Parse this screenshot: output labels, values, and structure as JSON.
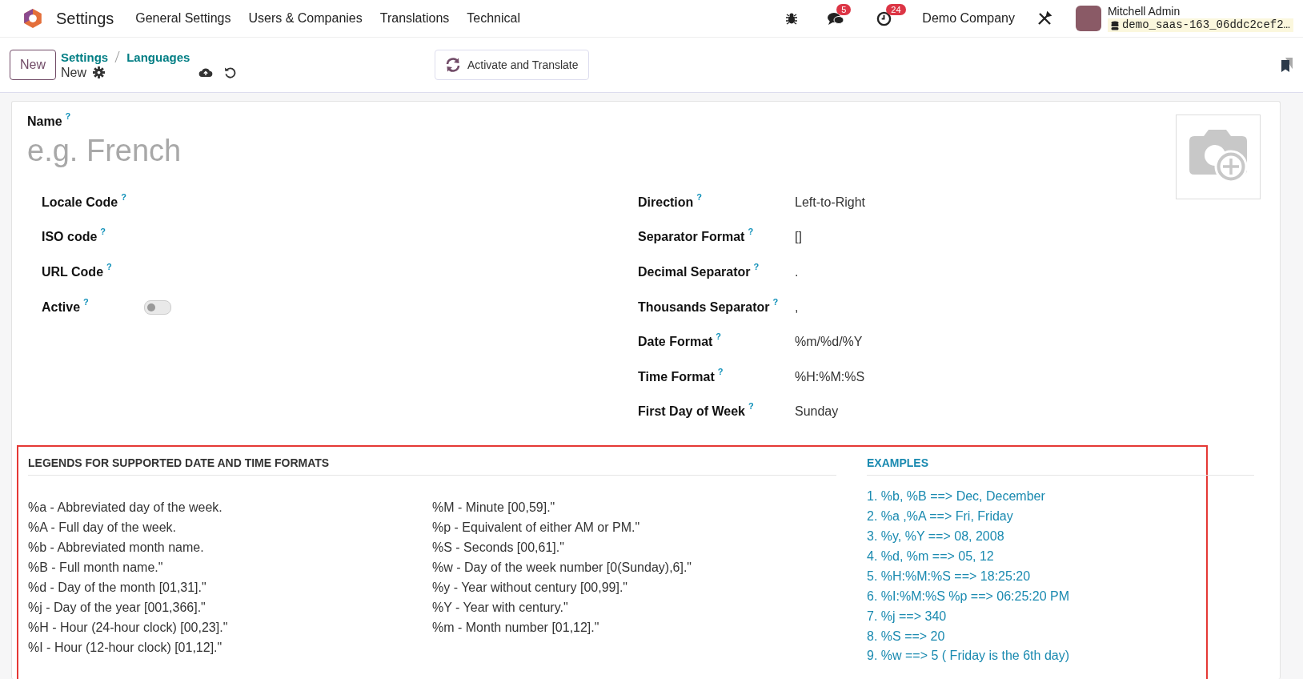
{
  "navbar": {
    "app_name": "Settings",
    "menu": [
      "General Settings",
      "Users & Companies",
      "Translations",
      "Technical"
    ],
    "chat_badge": "5",
    "activity_badge": "24",
    "company": "Demo Company",
    "user": {
      "name": "Mitchell Admin",
      "database": "demo_saas-163_06ddc2cef2…"
    }
  },
  "control_panel": {
    "new_button": "New",
    "breadcrumbs": [
      "Settings",
      "Languages"
    ],
    "record": "New",
    "action_button": "Activate and Translate"
  },
  "form": {
    "name": {
      "label": "Name",
      "help": "?",
      "placeholder": "e.g. French"
    },
    "left_fields": [
      {
        "kind": "text",
        "label": "Locale Code",
        "help": "?"
      },
      {
        "kind": "text",
        "label": "ISO code",
        "help": "?"
      },
      {
        "kind": "text",
        "label": "URL Code",
        "help": "?"
      },
      {
        "kind": "toggle",
        "label": "Active",
        "help": "?",
        "on": false
      }
    ],
    "right_fields": [
      {
        "label": "Direction",
        "help": "?",
        "value": "Left-to-Right"
      },
      {
        "label": "Separator Format",
        "help": "?",
        "value": "[]"
      },
      {
        "label": "Decimal Separator",
        "help": "?",
        "value": "."
      },
      {
        "label": "Thousands Separator",
        "help": "?",
        "value": ","
      },
      {
        "label": "Date Format",
        "help": "?",
        "value": "%m/%d/%Y"
      },
      {
        "label": "Time Format",
        "help": "?",
        "value": "%H:%M:%S"
      },
      {
        "label": "First Day of Week",
        "help": "?",
        "value": "Sunday"
      }
    ]
  },
  "legend": {
    "title": "LEGENDS FOR SUPPORTED DATE AND TIME FORMATS",
    "column_1": [
      "%a - Abbreviated day of the week.",
      "%A - Full day of the week.",
      "%b - Abbreviated month name.",
      "%B - Full month name.\"",
      "%d - Day of the month [01,31].\"",
      "%j - Day of the year [001,366].\"",
      "%H - Hour (24-hour clock) [00,23].\"",
      "%I - Hour (12-hour clock) [01,12].\""
    ],
    "column_2": [
      "%M - Minute [00,59].\"",
      "%p - Equivalent of either AM or PM.\"",
      "%S - Seconds [00,61].\"",
      "%w - Day of the week number [0(Sunday),6].\"",
      "%y - Year without century [00,99].\"",
      "%Y - Year with century.\"",
      "%m - Month number [01,12].\""
    ]
  },
  "examples": {
    "title": "EXAMPLES",
    "items": [
      "1. %b, %B ==> Dec, December",
      "2. %a ,%A ==> Fri, Friday",
      "3. %y, %Y ==> 08, 2008",
      "4. %d, %m ==> 05, 12",
      "5. %H:%M:%S ==> 18:25:20",
      "6. %I:%M:%S %p ==> 06:25:20 PM",
      "7. %j ==> 340",
      "8. %S ==> 20",
      "9. %w ==> 5 ( Friday is the 6th day)"
    ]
  }
}
